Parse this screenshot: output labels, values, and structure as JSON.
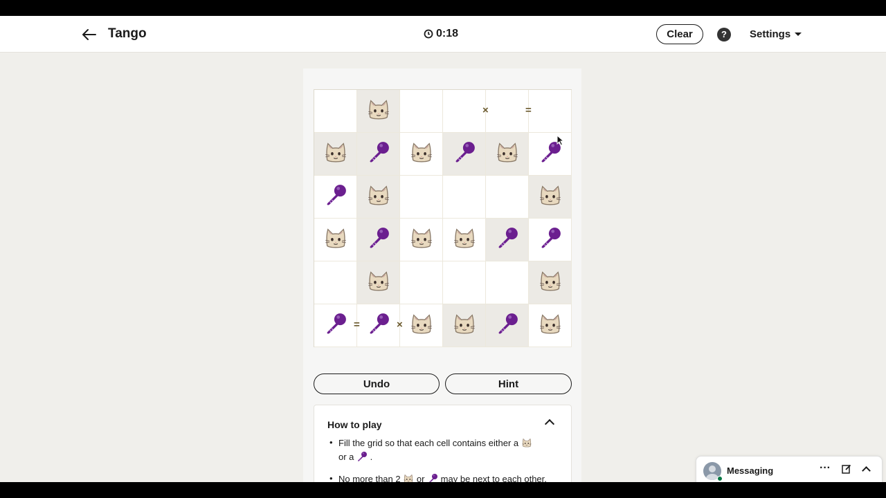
{
  "header": {
    "title": "Tango",
    "timer": "0:18",
    "clear_label": "Clear",
    "help_label": "?",
    "settings_label": "Settings"
  },
  "grid": {
    "size": 6,
    "cells": [
      [
        "empty",
        "locked-cat",
        "empty",
        "empty",
        "empty",
        "empty"
      ],
      [
        "locked-cat",
        "locked-mic",
        "cat",
        "locked-mic",
        "locked-cat",
        "mic"
      ],
      [
        "mic",
        "locked-cat",
        "empty",
        "empty",
        "empty",
        "locked-cat"
      ],
      [
        "cat",
        "locked-mic",
        "cat",
        "cat",
        "locked-mic",
        "mic"
      ],
      [
        "empty",
        "locked-cat",
        "empty",
        "empty",
        "empty",
        "locked-cat"
      ],
      [
        "mic",
        "mic",
        "cat",
        "locked-cat",
        "locked-mic",
        "cat"
      ]
    ],
    "constraints": [
      {
        "row": 0,
        "between": [
          3,
          4
        ],
        "direction": "horizontal",
        "sign": "×"
      },
      {
        "row": 0,
        "between": [
          4,
          5
        ],
        "direction": "horizontal",
        "sign": "="
      },
      {
        "row": 5,
        "between": [
          0,
          1
        ],
        "direction": "horizontal",
        "sign": "="
      },
      {
        "row": 5,
        "between": [
          1,
          2
        ],
        "direction": "horizontal",
        "sign": "×"
      }
    ]
  },
  "controls": {
    "undo_label": "Undo",
    "hint_label": "Hint"
  },
  "how_to_play": {
    "title": "How to play",
    "rule1_a": "Fill the grid so that each cell contains either a",
    "rule1_b": "or a",
    "rule1_c": ".",
    "rule2_a": "No more than 2",
    "rule2_b": "or",
    "rule2_c": "may be next to each other, either vertically or horizontally."
  },
  "messaging": {
    "label": "Messaging",
    "more_label": "···"
  },
  "colors": {
    "cat_fur": "#e8d9bf",
    "mic_purple": "#6b1f8f",
    "locked_bg": "#eceae5",
    "page_bg": "#f0efeb"
  }
}
